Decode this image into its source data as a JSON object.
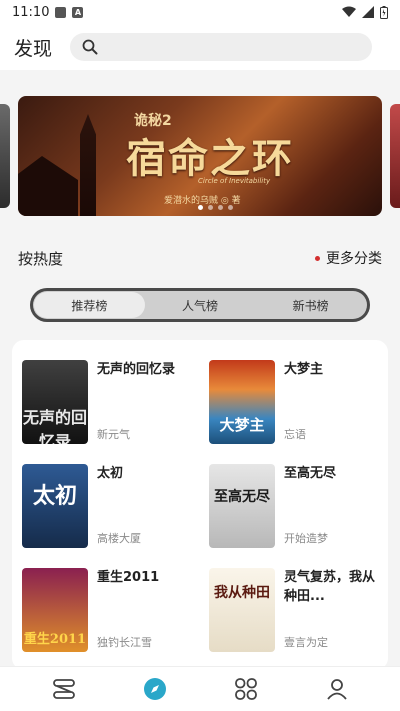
{
  "status": {
    "time": "11:10"
  },
  "header": {
    "title": "发现",
    "search_placeholder": ""
  },
  "banner": {
    "title_small": "诡秘2",
    "title_main": "宿命之环",
    "subtitle_en": "Circle of Inevitability",
    "author": "爱潜水的乌贼 ◎ 著",
    "page_count": 4,
    "active_page": 1
  },
  "section": {
    "title": "按热度",
    "more": "更多分类"
  },
  "tabs": [
    {
      "label": "推荐榜",
      "active": true
    },
    {
      "label": "人气榜",
      "active": false
    },
    {
      "label": "新书榜",
      "active": false
    }
  ],
  "books": [
    {
      "title": "无声的回忆录",
      "author": "新元气",
      "cover_text": "无声的回忆录"
    },
    {
      "title": "大梦主",
      "author": "忘语",
      "cover_text": "大梦主"
    },
    {
      "title": "太初",
      "author": "高楼大厦",
      "cover_text": "太初"
    },
    {
      "title": "至高无尽",
      "author": "开始造梦",
      "cover_text": "至高无尽"
    },
    {
      "title": "重生2011",
      "author": "独钓长江雪",
      "cover_text": "重生2011"
    },
    {
      "title": "灵气复苏，我从种田...",
      "author": "壹言为定",
      "cover_text": "我从种田"
    }
  ],
  "colors": {
    "accent": "#2aa7c9",
    "red_dot": "#d32f2f"
  },
  "nav": [
    "bookshelf-icon",
    "discover-icon",
    "category-icon",
    "profile-icon"
  ]
}
